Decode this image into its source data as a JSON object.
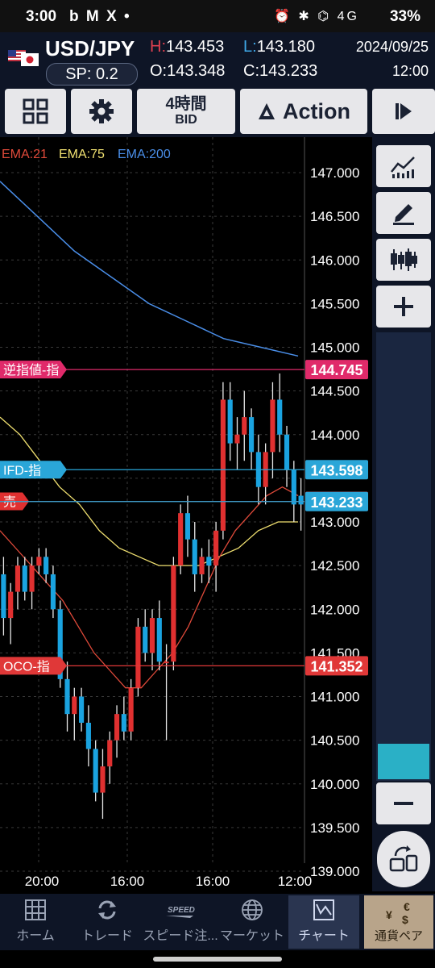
{
  "status_bar": {
    "time": "3:00",
    "notifications": "b M X •",
    "system_icons": "⏰ ✱ ⌬ 4G",
    "battery": "33%"
  },
  "header": {
    "pair": "USD/JPY",
    "spread": "SP: 0.2",
    "high_label": "H:",
    "high": "143.453",
    "low_label": "L:",
    "low": "143.180",
    "open": "O:143.348",
    "close": "C:143.233",
    "date": "2024/09/25",
    "time": "12:00"
  },
  "toolbar": {
    "timeframe": "4時間",
    "price_type": "BID",
    "action": "Action"
  },
  "indicators": {
    "ema21": "EMA:21",
    "ema75": "EMA:75",
    "ema200": "EMA:200"
  },
  "orders": {
    "stop": {
      "label": "逆指値-指",
      "price": "144.745"
    },
    "ifd": {
      "label": "IFD-指",
      "price": "143.598"
    },
    "sell": {
      "label": "売",
      "price": "143.235"
    },
    "current": {
      "price": "143.233"
    },
    "oco": {
      "label": "OCO-指",
      "price": "141.352"
    }
  },
  "colors": {
    "up": "#e03030",
    "down": "#1aa3e0",
    "ema21": "#e04a3a",
    "ema75": "#f0e070",
    "ema200": "#4a8ee8",
    "stop": "#e02a6a",
    "ifd": "#2aa6d8",
    "oco": "#e03838"
  },
  "chart_data": {
    "type": "candlestick",
    "y_ticks": [
      "147.000",
      "146.500",
      "146.000",
      "145.500",
      "145.000",
      "144.500",
      "144.000",
      "143.000",
      "142.500",
      "142.000",
      "141.500",
      "141.000",
      "140.500",
      "140.000",
      "139.500",
      "139.000"
    ],
    "x_ticks": [
      "20:00",
      "16:00",
      "16:00",
      "12:00"
    ],
    "ylim": [
      139.0,
      147.2
    ],
    "candles": [
      [
        142.4,
        142.6,
        141.7,
        141.9
      ],
      [
        141.9,
        142.3,
        141.6,
        142.2
      ],
      [
        142.2,
        142.6,
        142.0,
        142.5
      ],
      [
        142.5,
        142.6,
        142.1,
        142.2
      ],
      [
        142.2,
        142.6,
        142.0,
        142.5
      ],
      [
        142.5,
        142.7,
        142.4,
        142.6
      ],
      [
        142.6,
        142.7,
        142.3,
        142.4
      ],
      [
        142.4,
        142.5,
        141.9,
        142.0
      ],
      [
        142.0,
        142.1,
        141.1,
        141.2
      ],
      [
        141.2,
        141.4,
        140.6,
        140.8
      ],
      [
        140.8,
        141.1,
        140.5,
        141.0
      ],
      [
        141.0,
        141.1,
        140.6,
        140.7
      ],
      [
        140.7,
        140.9,
        140.2,
        140.4
      ],
      [
        140.4,
        140.5,
        139.8,
        139.9
      ],
      [
        139.9,
        140.4,
        139.6,
        140.2
      ],
      [
        140.2,
        140.6,
        140.0,
        140.5
      ],
      [
        140.5,
        140.9,
        140.3,
        140.8
      ],
      [
        140.8,
        141.0,
        140.5,
        140.6
      ],
      [
        140.6,
        141.2,
        140.5,
        141.1
      ],
      [
        141.1,
        141.9,
        141.0,
        141.8
      ],
      [
        141.8,
        142.0,
        141.4,
        141.5
      ],
      [
        141.5,
        142.0,
        141.3,
        141.9
      ],
      [
        141.9,
        142.1,
        141.3,
        141.4
      ],
      [
        141.4,
        141.6,
        140.5,
        141.4
      ],
      [
        141.4,
        142.6,
        141.3,
        142.5
      ],
      [
        142.5,
        143.2,
        142.4,
        143.1
      ],
      [
        143.1,
        143.3,
        142.6,
        142.8
      ],
      [
        142.8,
        143.0,
        142.2,
        142.4
      ],
      [
        142.4,
        142.7,
        142.3,
        142.6
      ],
      [
        142.6,
        142.8,
        142.3,
        142.5
      ],
      [
        142.5,
        143.0,
        142.2,
        142.9
      ],
      [
        142.9,
        144.6,
        142.8,
        144.4
      ],
      [
        144.4,
        144.6,
        143.7,
        143.9
      ],
      [
        143.9,
        144.2,
        143.6,
        144.0
      ],
      [
        144.0,
        144.5,
        143.7,
        144.2
      ],
      [
        144.2,
        144.3,
        143.6,
        143.8
      ],
      [
        143.8,
        144.0,
        143.2,
        143.4
      ],
      [
        143.4,
        143.9,
        143.2,
        143.8
      ],
      [
        143.8,
        144.6,
        143.5,
        144.4
      ],
      [
        144.4,
        144.7,
        143.8,
        144.0
      ],
      [
        144.0,
        144.1,
        143.4,
        143.6
      ],
      [
        143.6,
        143.7,
        143.0,
        143.2
      ],
      [
        143.3,
        143.5,
        142.9,
        143.2
      ]
    ],
    "ema21": [
      142.9,
      142.7,
      142.5,
      142.3,
      142.1,
      141.8,
      141.5,
      141.3,
      141.1,
      141.1,
      141.3,
      141.5,
      141.8,
      142.2,
      142.6,
      142.9,
      143.1,
      143.3,
      143.4,
      143.3
    ],
    "ema75": [
      144.2,
      144.0,
      143.7,
      143.4,
      143.2,
      142.9,
      142.7,
      142.6,
      142.5,
      142.5,
      142.5,
      142.6,
      142.7,
      142.9,
      143.0,
      143.0
    ],
    "ema200": [
      146.9,
      146.5,
      146.1,
      145.8,
      145.5,
      145.3,
      145.1,
      145.0,
      144.9
    ]
  },
  "side_panel": {
    "icons": [
      "line-chart-icon",
      "draw-icon",
      "candles-icon",
      "zoom-in-icon",
      "zoom-out-icon",
      "rotate-icon"
    ]
  },
  "bottom_nav": [
    {
      "label": "ホーム"
    },
    {
      "label": "トレード"
    },
    {
      "label": "スピード注..."
    },
    {
      "label": "マーケット"
    },
    {
      "label": "チャート"
    },
    {
      "label": "通貨ペア"
    }
  ]
}
